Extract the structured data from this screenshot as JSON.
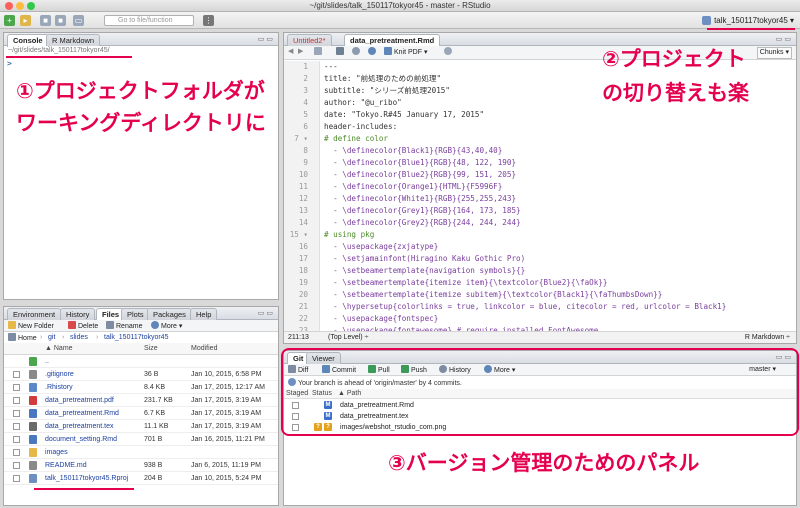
{
  "window": {
    "title": "~/git/slides/talk_150117tokyor45 - master - RStudio"
  },
  "toolbar": {
    "goto_placeholder": "Go to file/function",
    "project_label": "talk_150117tokyor45 ▾"
  },
  "console_pane": {
    "tabs": [
      "Console",
      "R Markdown"
    ],
    "path": "~/git/slides/talk_150117tokyor45/",
    "prompt": ">"
  },
  "files_pane": {
    "tabs": [
      "Environment",
      "History",
      "Files",
      "Plots",
      "Packages",
      "Help"
    ],
    "actions": {
      "new_folder": "New Folder",
      "delete": "Delete",
      "rename": "Rename",
      "more": "More ▾"
    },
    "breadcrumb": [
      "Home",
      "git",
      "slides",
      "talk_150117tokyor45"
    ],
    "columns": {
      "name": "▲ Name",
      "size": "Size",
      "modified": "Modified"
    },
    "up_label": "..",
    "rows": [
      {
        "name": ".gitignore",
        "size": "36 B",
        "modified": "Jan 10, 2015, 6:58 PM",
        "color": "#8a8a8a"
      },
      {
        "name": ".Rhistory",
        "size": "8.4 KB",
        "modified": "Jan 17, 2015, 12:17 AM",
        "color": "#5a88c8"
      },
      {
        "name": "data_pretreatment.pdf",
        "size": "231.7 KB",
        "modified": "Jan 17, 2015, 3:19 AM",
        "color": "#d13b3b"
      },
      {
        "name": "data_pretreatment.Rmd",
        "size": "6.7 KB",
        "modified": "Jan 17, 2015, 3:19 AM",
        "color": "#4a78c0"
      },
      {
        "name": "data_pretreatment.tex",
        "size": "11.1 KB",
        "modified": "Jan 17, 2015, 3:19 AM",
        "color": "#6a6a6a"
      },
      {
        "name": "document_setting.Rmd",
        "size": "701 B",
        "modified": "Jan 16, 2015, 11:21 PM",
        "color": "#4a78c0"
      },
      {
        "name": "images",
        "size": "",
        "modified": "",
        "color": "#e6b84a"
      },
      {
        "name": "README.md",
        "size": "938 B",
        "modified": "Jan 6, 2015, 11:19 PM",
        "color": "#8a8a8a"
      },
      {
        "name": "talk_150117tokyor45.Rproj",
        "size": "204 B",
        "modified": "Jan 10, 2015, 5:24 PM",
        "color": "#6d8fc2"
      }
    ]
  },
  "editor_pane": {
    "tabs": [
      "Untitled2*",
      "data_pretreatment.Rmd"
    ],
    "knit_label": "Knit PDF ▾",
    "chunks_label": "Chunks ▾",
    "lines": [
      {
        "n": "1",
        "t": "---",
        "k": ""
      },
      {
        "n": "2",
        "t": "title: \"前処理のための前処理\"",
        "k": ""
      },
      {
        "n": "3",
        "t": "subtitle: \"シリーズ前処理2015\"",
        "k": ""
      },
      {
        "n": "4",
        "t": "author: \"@u_ribo\"",
        "k": ""
      },
      {
        "n": "5",
        "t": "date: \"Tokyo.R#45 January 17, 2015\"",
        "k": ""
      },
      {
        "n": "6",
        "t": "header-includes:",
        "k": ""
      },
      {
        "n": "7 ▾",
        "t": "# define color",
        "k": "cm"
      },
      {
        "n": "8",
        "t": "  - \\definecolor{Black1}{RGB}{43,40,40}",
        "k": "kw"
      },
      {
        "n": "9",
        "t": "  - \\definecolor{Blue1}{RGB}{48, 122, 190}",
        "k": "kw"
      },
      {
        "n": "10",
        "t": "  - \\definecolor{Blue2}{RGB}{99, 151, 205}",
        "k": "kw"
      },
      {
        "n": "11",
        "t": "  - \\definecolor{Orange1}{HTML}{F5996F}",
        "k": "kw"
      },
      {
        "n": "12",
        "t": "  - \\definecolor{White1}{RGB}{255,255,243}",
        "k": "kw"
      },
      {
        "n": "13",
        "t": "  - \\definecolor{Grey1}{RGB}{164, 173, 185}",
        "k": "kw"
      },
      {
        "n": "14",
        "t": "  - \\definecolor{Grey2}{RGB}{244, 244, 244}",
        "k": "kw"
      },
      {
        "n": "15 ▾",
        "t": "# using pkg",
        "k": "cm"
      },
      {
        "n": "16",
        "t": "  - \\usepackage{zxjatype}",
        "k": "kw"
      },
      {
        "n": "17",
        "t": "  - \\setjamainfont(Hiragino Kaku Gothic Pro)",
        "k": "kw"
      },
      {
        "n": "18",
        "t": "  - \\setbeamertemplate{navigation symbols}{}",
        "k": "kw"
      },
      {
        "n": "19",
        "t": "  - \\setbeamertemplate{itemize item}{\\textcolor{Blue2}{\\faOk}}",
        "k": "kw"
      },
      {
        "n": "20",
        "t": "  - \\setbeamertemplate{itemize subitem}{\\textcolor{Black1}{\\faThumbsDown}}",
        "k": "kw"
      },
      {
        "n": "21",
        "t": "  - \\hypersetup{colorlinks = true, linkcolor = blue, citecolor = red, urlcolor = Black1}",
        "k": "kw"
      },
      {
        "n": "22",
        "t": "  - \\usepackage{fontspec}",
        "k": "kw"
      },
      {
        "n": "23",
        "t": "  - \\usepackage{fontawesome} # require installed FontAwesome",
        "k": "kw"
      }
    ],
    "status_pos": "211:13",
    "status_scope": "(Top Level) ÷",
    "status_mode": "R Markdown ÷"
  },
  "git_pane": {
    "tabs": [
      "Git",
      "Viewer"
    ],
    "actions": {
      "diff": "Diff",
      "commit": "Commit",
      "pull": "Pull",
      "push": "Push",
      "history": "History",
      "more": "More ▾"
    },
    "branch": "master ▾",
    "ahead_msg": "Your branch is ahead of 'origin/master' by 4 commits.",
    "columns": {
      "staged": "Staged",
      "status": "Status",
      "path": "▲ Path"
    },
    "rows": [
      {
        "path": "data_pretreatment.Rmd",
        "status": "M",
        "color": "#3b6fc9"
      },
      {
        "path": "data_pretreatment.tex",
        "status": "M",
        "color": "#3b6fc9"
      },
      {
        "path": "images/webshot_rstudio_com.png",
        "status": "??",
        "color": "#e3a21a"
      }
    ]
  },
  "annotations": {
    "a1_line1": "①プロジェクトフォルダが",
    "a1_line2": "ワーキングディレクトリに",
    "a2_line1": "②プロジェクト",
    "a2_line2": "の切り替えも楽",
    "a3": "③バージョン管理のためのパネル"
  },
  "colors": {
    "accent": "#e5004f"
  }
}
